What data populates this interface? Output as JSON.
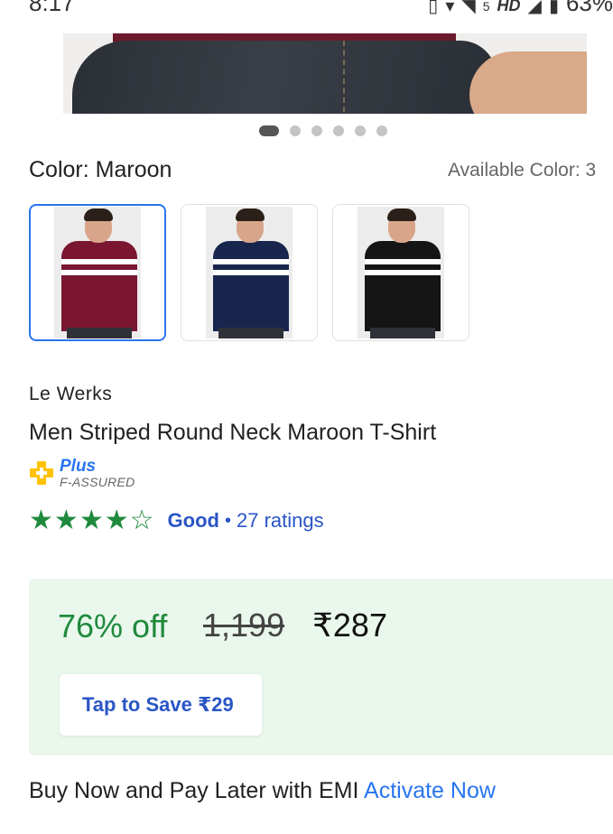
{
  "status_bar": {
    "time": "8:17",
    "network_label": "5",
    "hd_label": "HD",
    "battery": "63%"
  },
  "gallery": {
    "total_images": 6,
    "active_index": 0
  },
  "color": {
    "label": "Color:",
    "value": "Maroon",
    "available_text": "Available Color: 3",
    "options": [
      {
        "name": "maroon",
        "hex": "#7a1630",
        "selected": true
      },
      {
        "name": "navy",
        "hex": "#18264d",
        "selected": false
      },
      {
        "name": "black",
        "hex": "#151515",
        "selected": false
      }
    ]
  },
  "product": {
    "brand": "Le Werks",
    "title": "Men Striped Round Neck Maroon T-Shirt"
  },
  "assured_badge": {
    "plus_text": "Plus",
    "assured_text": "F-ASSURED"
  },
  "rating": {
    "stars_filled": 4,
    "stars_total": 5,
    "label": "Good",
    "separator": "•",
    "count_text": "27 ratings"
  },
  "pricing": {
    "discount": "76% off",
    "mrp": "1,199",
    "price": "₹287",
    "save_button": "Tap to Save ₹29"
  },
  "emi": {
    "text": "Buy Now and Pay Later with EMI",
    "link": "Activate Now"
  },
  "colors": {
    "accent_blue": "#2874f0",
    "link_blue": "#2a55c5",
    "green": "#1f8a3d",
    "price_bg": "#e9f7ec"
  }
}
